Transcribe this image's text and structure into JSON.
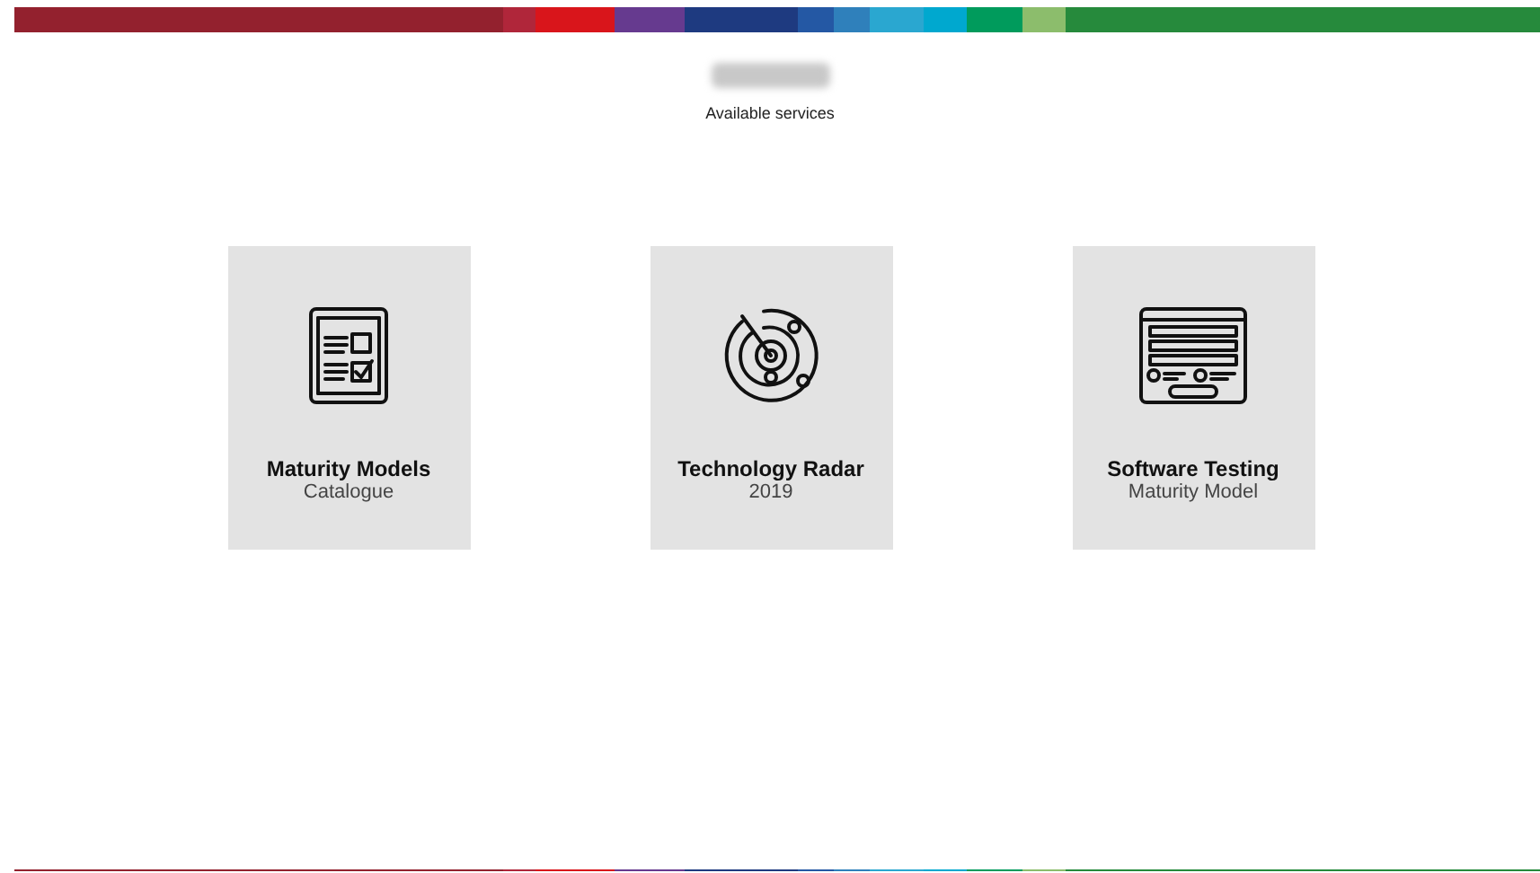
{
  "header": {
    "subtitle": "Available services"
  },
  "services": [
    {
      "kind": "checklist",
      "title": "Maturity Models",
      "subtitle": "Catalogue"
    },
    {
      "kind": "radar",
      "title": "Technology Radar",
      "subtitle": "2019"
    },
    {
      "kind": "form",
      "title": "Software Testing",
      "subtitle": "Maturity Model"
    }
  ]
}
